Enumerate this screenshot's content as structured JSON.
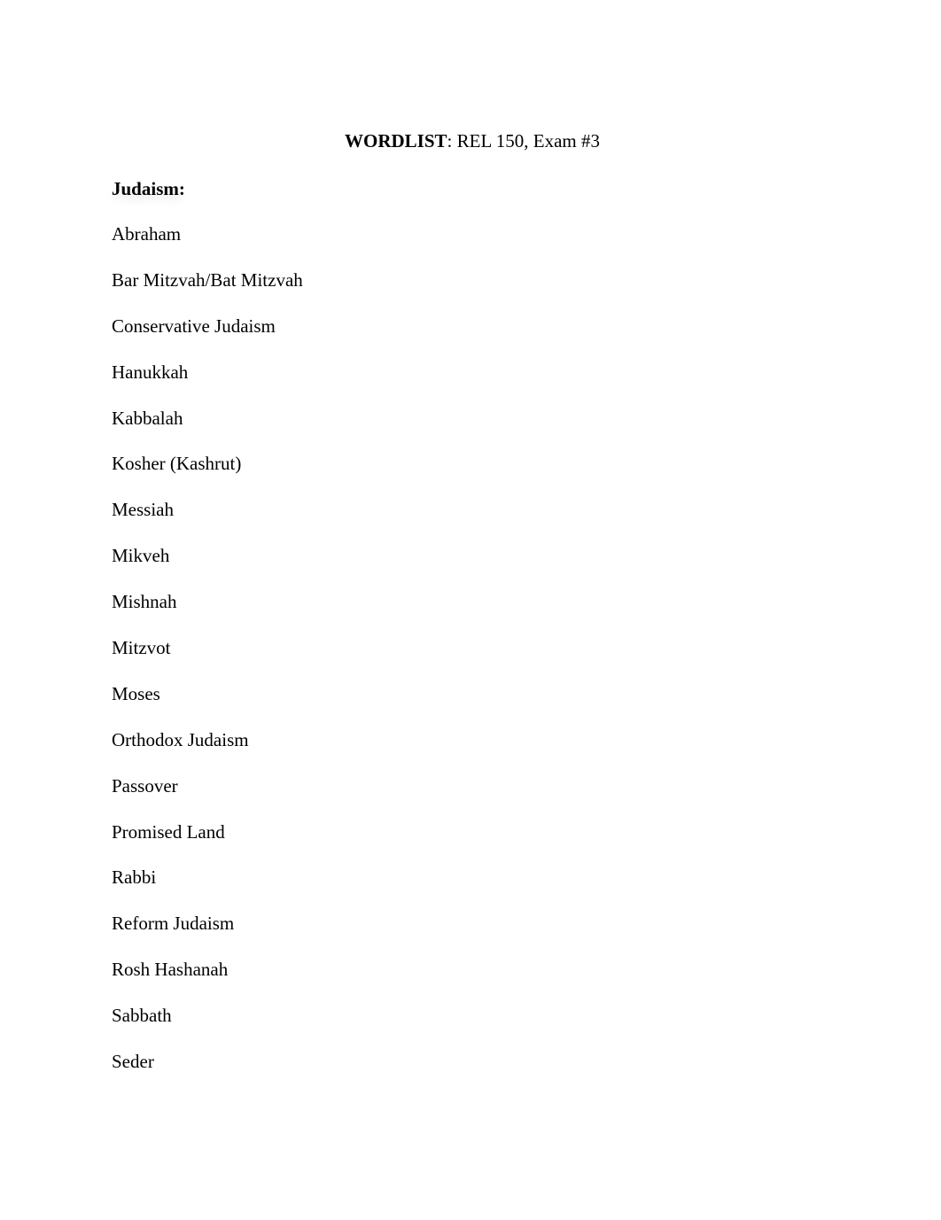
{
  "document": {
    "title": {
      "bold_part": "WORDLIST",
      "rest": ": REL 150, Exam #3"
    },
    "sections": [
      {
        "heading": "Judaism:",
        "terms": [
          "Abraham",
          "Bar Mitzvah/Bat Mitzvah",
          "Conservative Judaism",
          "Hanukkah",
          "Kabbalah",
          "Kosher (Kashrut)",
          "Messiah",
          "Mikveh",
          "Mishnah",
          "Mitzvot",
          "Moses",
          "Orthodox Judaism",
          "Passover",
          "Promised Land",
          "Rabbi",
          "Reform Judaism",
          "Rosh Hashanah",
          "Sabbath",
          "Seder"
        ]
      }
    ]
  }
}
